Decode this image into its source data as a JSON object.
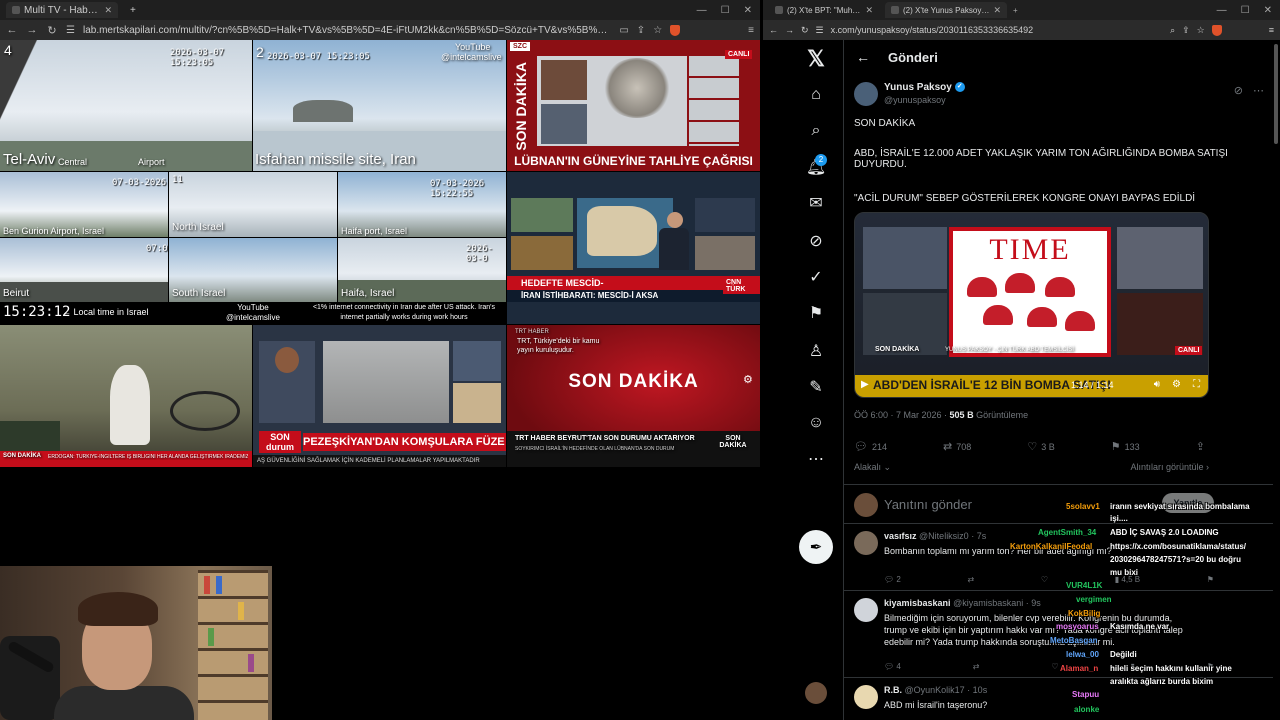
{
  "left_browser": {
    "tabs": [
      {
        "title": "Multi TV - Haber kanallarını ayn",
        "active": true
      },
      {
        "title": "+",
        "active": false
      }
    ],
    "url": "lab.mertskapilari.com/multitv/?cn%5B%5D=Halk+TV&vs%5B%5D=4E-iFtUM2kk&cn%5B%5D=Sözcü+TV&vs%5B%5D=ztmY_cOtUI0&cn%5..."
  },
  "feeds": {
    "tel_aviv": {
      "num": "4",
      "time": "2026-03-07 15:23:05",
      "place": "Tel-Aviv",
      "sub1": "Central",
      "sub2": "Airport"
    },
    "isfahan": {
      "num": "2",
      "time": "2026-03-07 15:23:05",
      "place": "Isfahan missile site, Iran",
      "yt1": "YouTube",
      "yt2": "@intelcamslive"
    },
    "szc": {
      "headline": "LÜBNAN'IN GÜNEYİNE TAHLİYE ÇAĞRISI",
      "vert": "SON DAKİKA",
      "live": "CANLI",
      "logo": "SZC"
    },
    "ben_gurion": {
      "time": "07-03-2026",
      "label": "Ben Gurion Airport, Israel"
    },
    "north": {
      "num": "11",
      "label": "North Israel"
    },
    "haifa_port": {
      "time": "07-03-2026 15:22:55",
      "label": "Haifa port, Israel"
    },
    "beirut": {
      "label": "Beirut",
      "num": "07:0"
    },
    "south": {
      "label": "South Israel"
    },
    "haifa": {
      "label": "Haifa, Israel",
      "time": "2026-03-0"
    },
    "cnn": {
      "bar1": "HEDEFTE MESCİD-",
      "bar2": "İRAN İSTİHBARATI: MESCİD-İ AKSA",
      "tag": "SON DAKİKA",
      "logo": "CNN TÜRK"
    },
    "infobar": {
      "clock": "15:23:12",
      "local": "← Local time in Israel",
      "yt1": "YouTube",
      "yt2": "@intelcamslive",
      "conn": "<1% internet connectivity in Iran due after US attack. Iran's internet partially works during work hours"
    },
    "erdogan": {
      "tag": "SON DAKİKA",
      "ticker": "ERDOĞAN: TÜRKİYE-İNGİLTERE İŞ BİRLİĞİNİ HER ALANDA GELİŞTİRMEK İRADEMİZİN GÜÇLÜ OLDUĞUNU SÖYLEDİ"
    },
    "halk": {
      "headline": "PEZEŞKİYAN'DAN KOMŞULARA FÜZE ÖZRÜ",
      "tag": "SON durum",
      "ticker": "AŞ GÜVENLİĞİNİ SAĞLAMAK İÇİN KADEMELİ PLANLAMALAR YAPILMAKTADIR"
    },
    "trt": {
      "note": "TRT, Türkiye'deki bir kamu yayın kuruluşudur.",
      "brand": "TRT HABER",
      "big": "SON DAKİKA",
      "bar": "TRT HABER BEYRUT'TAN SON DURUMU AKTARIYOR",
      "sub": "SOYKIRIMCI İSRAİL'İN HEDEFİNDE OLAN LÜBNAN'DA SON DURUM",
      "tag": "SON DAKİKA"
    }
  },
  "right_browser": {
    "tabs": [
      {
        "title": "(2) X'te BPT: \"Muhabir: \"Rusya, İran'ı",
        "active": false
      },
      {
        "title": "(2) X'te Yunus Paksoy: \"SON DA...",
        "active": true
      }
    ],
    "url": "x.com/yunuspaksoy/status/2030116353336635492"
  },
  "x": {
    "header": "Gönderi",
    "notification_count": "2",
    "author": {
      "name": "Yunus Paksoy",
      "handle": "@yunuspaksoy"
    },
    "post_lines": [
      "SON DAKİKA",
      "ABD, İSRAİL'E 12.000 ADET YAKLAŞIK YARIM TON AĞIRLIĞINDA BOMBA SATIŞI DUYURDU.",
      "\"ACİL DURUM\" SEBEP GÖSTERİLEREK KONGRE ONAYI BAYPAS EDİLDİ"
    ],
    "video": {
      "magazine": "TIME",
      "caption": "ABD'DEN İSRAİL'E 12 BİN BOMBA SATIŞI",
      "time": "1:14 / 1:14",
      "live": "CANLI",
      "lower_left": "SON DAKİKA",
      "lower_name": "YUNUS PAKSOY - ÇIN TÜRK ABD TEMSİLCİSİ"
    },
    "meta": {
      "time": "ÖÖ 6:00 · 7 Mar 2026 · ",
      "views": "505 B",
      "views_label": " Görüntüleme"
    },
    "stats": {
      "replies": "214",
      "reposts": "708",
      "likes": "3 B",
      "bookmarks": "133"
    },
    "tagged": "Alakalı",
    "quotes": "Alıntıları görüntüle",
    "reply_placeholder": "Yanıtını gönder",
    "reply_button": "Yanıtla",
    "replies": [
      {
        "name": "vasıfsız",
        "handle": "@Niteliksiz0 · 7s",
        "text": "Bombanın toplamı mı yarım ton? Her bir adet ağırlığı mı?",
        "r": "2",
        "l": "",
        "v": "4,5 B"
      },
      {
        "name": "kiyamisbaskani",
        "handle": "@kiyamisbaskani · 9s",
        "text": "Bilmediğim için soruyorum, bilenler cvp verebilir. Kongrenin bu durumda, trump ve ekibi için bir yaptırım hakkı var mı? Yada kongre acil toplantı talep edebilir mi? Yada trump hakkında soruşturma açılabilir mi.",
        "r": "4",
        "l": "",
        "v": ""
      },
      {
        "name": "R.B.",
        "handle": "@OyunKolik17 · 10s",
        "text": "ABD mi İsrail'in taşeronu?",
        "r": "",
        "l": "",
        "v": ""
      }
    ]
  },
  "chat": [
    {
      "user": "5solavv1",
      "msg": "iranın sevkiyat sırasında bombalama"
    },
    {
      "user": "",
      "msg": "işi...."
    },
    {
      "user": "AgentSmith_34",
      "msg": "ABD İÇ SAVAŞ 2.0 LOADING"
    },
    {
      "user": "KartonKalkaniIFeodal",
      "msg": "https://x.com/bosunatiklama/status/"
    },
    {
      "user": "",
      "msg": "2030296478247571?s=20 bu doğru"
    },
    {
      "user": "",
      "msg": "mu bixi"
    },
    {
      "user": "VUR4L1K",
      "msg": ""
    },
    {
      "user": "vergimen",
      "msg": ""
    },
    {
      "user": "KokBilig",
      "msg": ""
    },
    {
      "user": "mosyoarus",
      "msg": "Kasımda ne var"
    },
    {
      "user": "MetoBasgan",
      "msg": ""
    },
    {
      "user": "lelwa_00",
      "msg": "Değildi"
    },
    {
      "user": "Alaman_n",
      "msg": "hileli seçim hakkını kullanır yine"
    },
    {
      "user": "",
      "msg": "aralıkta ağlarız burda bixim"
    },
    {
      "user": "Stapuu",
      "msg": ""
    },
    {
      "user": "alonke",
      "msg": ""
    }
  ]
}
